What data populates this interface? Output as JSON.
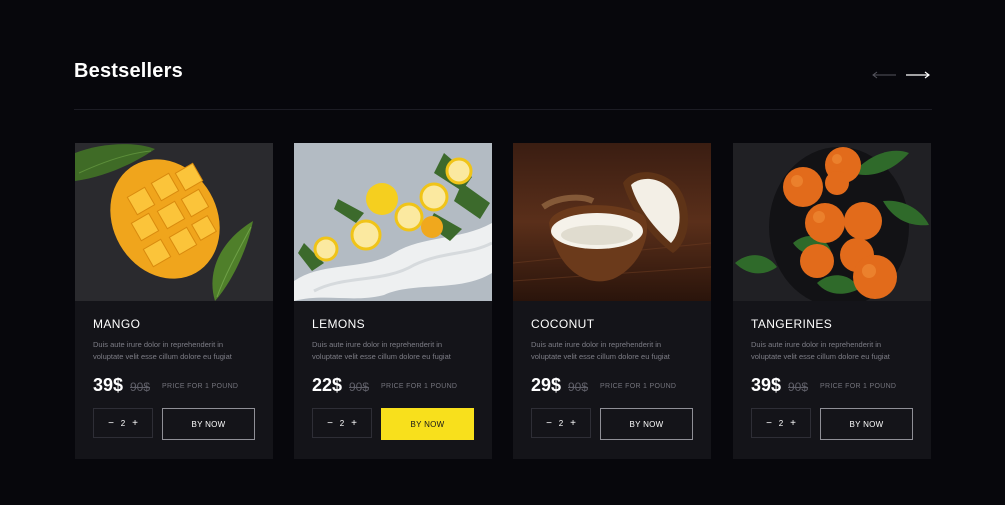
{
  "section": {
    "title": "Bestsellers"
  },
  "products": [
    {
      "name": "MANGO",
      "desc_lines": [
        "Duis aute irure dolor in reprehenderit in",
        "voluptate velit esse cillum dolore eu fugiat"
      ],
      "price": "39$",
      "old_price": "90$",
      "unit": "PRICE FOR 1 POUND",
      "qty": "2",
      "minus": "−",
      "plus": "+",
      "buy_label": "BY NOW",
      "buy_active": false
    },
    {
      "name": "LEMONS",
      "desc_lines": [
        "Duis aute irure dolor in reprehenderit in",
        "voluptate velit esse cillum dolore eu fugiat"
      ],
      "price": "22$",
      "old_price": "90$",
      "unit": "PRICE FOR 1 POUND",
      "qty": "2",
      "minus": "−",
      "plus": "+",
      "buy_label": "BY NOW",
      "buy_active": true
    },
    {
      "name": "COCONUT",
      "desc_lines": [
        "Duis aute irure dolor in reprehenderit in",
        "voluptate velit esse cillum dolore eu fugiat"
      ],
      "price": "29$",
      "old_price": "90$",
      "unit": "PRICE FOR 1 POUND",
      "qty": "2",
      "minus": "−",
      "plus": "+",
      "buy_label": "BY NOW",
      "buy_active": false
    },
    {
      "name": "TANGERINES",
      "desc_lines": [
        "Duis aute irure dolor in reprehenderit in",
        "voluptate velit esse cillum dolore eu fugiat"
      ],
      "price": "39$",
      "old_price": "90$",
      "unit": "PRICE FOR 1 POUND",
      "qty": "2",
      "minus": "−",
      "plus": "+",
      "buy_label": "BY NOW",
      "buy_active": false
    }
  ],
  "colors": {
    "background": "#07070c",
    "card": "#141419",
    "accent": "#f8e01c"
  },
  "icons": {
    "prev": "arrow-left-icon",
    "next": "arrow-right-icon"
  }
}
